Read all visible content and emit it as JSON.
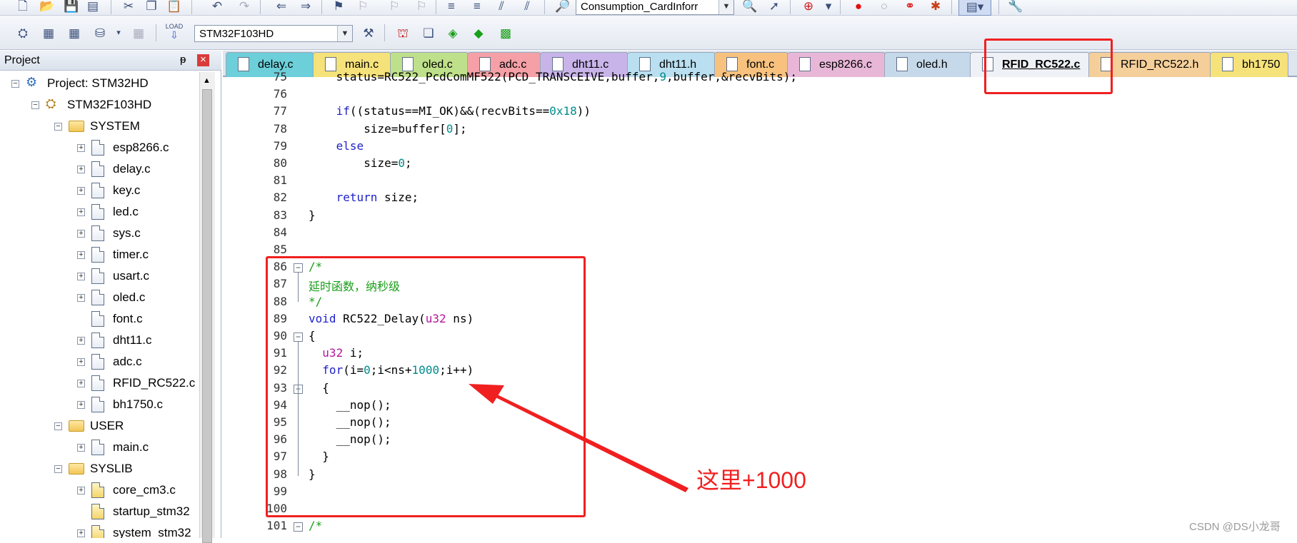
{
  "toolbar1": {
    "project_combo": "Consumption_CardInforr"
  },
  "toolbar2": {
    "target_combo": "STM32F103HD",
    "load_label": "LOAD"
  },
  "project_panel": {
    "title": "Project",
    "pin_glyph": "ᵽ",
    "close_glyph": "×",
    "root": "Project: STM32HD",
    "target": "STM32F103HD",
    "groups": [
      {
        "name": "SYSTEM",
        "files": [
          "esp8266.c",
          "delay.c",
          "key.c",
          "led.c",
          "sys.c",
          "timer.c",
          "usart.c",
          "oled.c",
          "font.c",
          "dht11.c",
          "adc.c",
          "RFID_RC522.c",
          "bh1750.c"
        ]
      },
      {
        "name": "USER",
        "files": [
          "main.c"
        ]
      },
      {
        "name": "SYSLIB",
        "files": [
          "core_cm3.c",
          "startup_stm32",
          "system_stm32"
        ]
      }
    ]
  },
  "tabs": [
    {
      "label": "delay.c",
      "color": "#6ccfd9"
    },
    {
      "label": "main.c",
      "color": "#f6e27a"
    },
    {
      "label": "oled.c",
      "color": "#bfe08a"
    },
    {
      "label": "adc.c",
      "color": "#f4a0a6"
    },
    {
      "label": "dht11.c",
      "color": "#c9b4ea"
    },
    {
      "label": "dht11.h",
      "color": "#b9dff0"
    },
    {
      "label": "font.c",
      "color": "#f8c27e"
    },
    {
      "label": "esp8266.c",
      "color": "#e8b7d8"
    },
    {
      "label": "oled.h",
      "color": "#c6d9ea"
    },
    {
      "label": "RFID_RC522.c",
      "color": "#e9edf4"
    },
    {
      "label": "RFID_RC522.h",
      "color": "#f5cf9a"
    },
    {
      "label": "bh1750",
      "color": "#f6e27a"
    }
  ],
  "code_lines": [
    {
      "n": "75",
      "text": "status=RC522_PcdComMF522(PCD_TRANSCEIVE,buffer,9,buffer,&recvBits);"
    },
    {
      "n": "76",
      "text": ""
    },
    {
      "n": "77",
      "text": "if((status==MI_OK)&&(recvBits==0x18))"
    },
    {
      "n": "78",
      "text": "size=buffer[0];"
    },
    {
      "n": "79",
      "text": "else"
    },
    {
      "n": "80",
      "text": "size=0;"
    },
    {
      "n": "81",
      "text": ""
    },
    {
      "n": "82",
      "text": "return size;"
    },
    {
      "n": "83",
      "text": "}"
    },
    {
      "n": "84",
      "text": ""
    },
    {
      "n": "85",
      "text": ""
    },
    {
      "n": "86",
      "text": "/*"
    },
    {
      "n": "87",
      "text": "延时函数，纳秒级"
    },
    {
      "n": "88",
      "text": "*/"
    },
    {
      "n": "89",
      "text": "void RC522_Delay(u32 ns)"
    },
    {
      "n": "90",
      "text": "{"
    },
    {
      "n": "91",
      "text": "u32 i;"
    },
    {
      "n": "92",
      "text": "for(i=0;i<ns+1000;i++)"
    },
    {
      "n": "93",
      "text": "{"
    },
    {
      "n": "94",
      "text": "__nop();"
    },
    {
      "n": "95",
      "text": "__nop();"
    },
    {
      "n": "96",
      "text": "__nop();"
    },
    {
      "n": "97",
      "text": "}"
    },
    {
      "n": "98",
      "text": "}"
    },
    {
      "n": "99",
      "text": ""
    },
    {
      "n": "100",
      "text": ""
    },
    {
      "n": "101",
      "text": "/*"
    }
  ],
  "annotation": "这里+1000",
  "watermark": "CSDN @DS小龙哥",
  "colors": {
    "highlight": "#f02020",
    "keyword": "#1f22c9",
    "number": "#008b8b",
    "comment": "#1a9e1a",
    "type": "#b3159e"
  }
}
